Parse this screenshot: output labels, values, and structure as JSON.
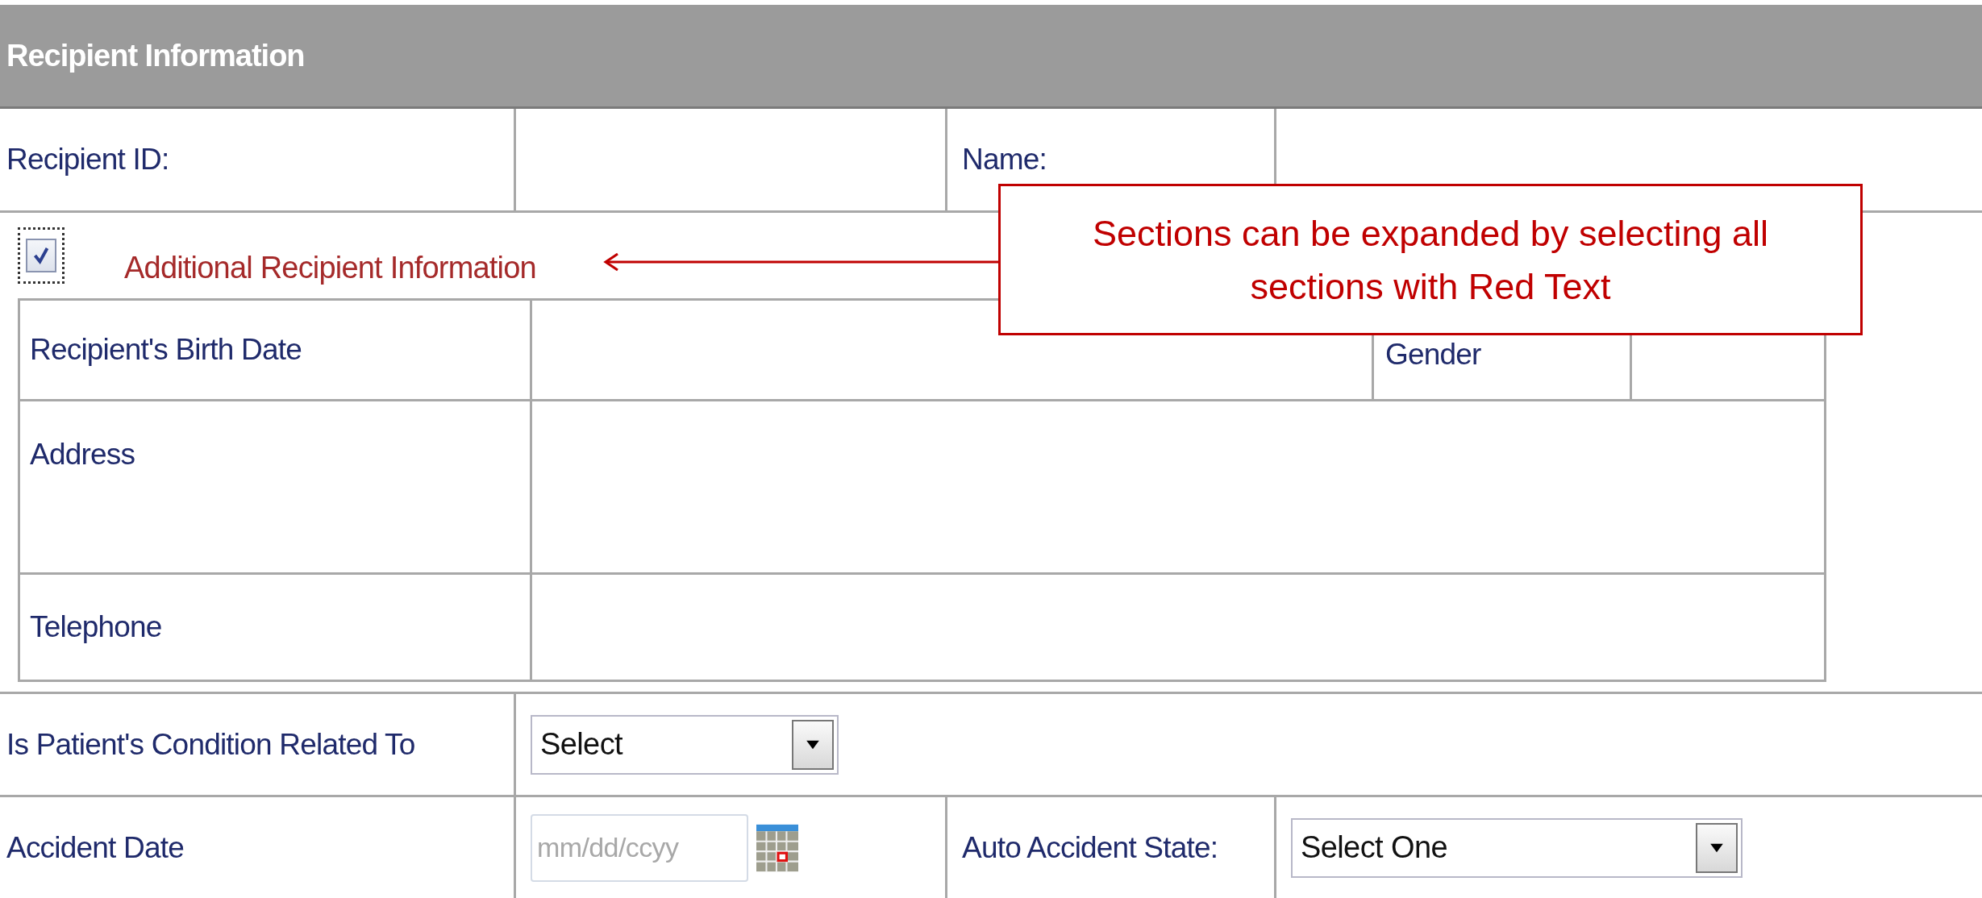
{
  "header": {
    "title": "Recipient Information"
  },
  "id_row": {
    "id_label": "Recipient ID:",
    "name_label": "Name:"
  },
  "additional": {
    "label": "Additional Recipient Information",
    "checked": true,
    "rows": [
      {
        "label": "Recipient's Birth Date",
        "extra_label": "Gender"
      },
      {
        "label": "Address"
      },
      {
        "label": "Telephone"
      }
    ]
  },
  "callout": {
    "text": "Sections can be expanded by selecting all sections with Red Text"
  },
  "condition": {
    "label": "Is Patient's Condition Related To",
    "select_value": "Select"
  },
  "accident": {
    "date_label": "Accident Date",
    "date_placeholder": "mm/dd/ccyy",
    "state_label": "Auto Accident State:",
    "state_value": "Select One"
  }
}
